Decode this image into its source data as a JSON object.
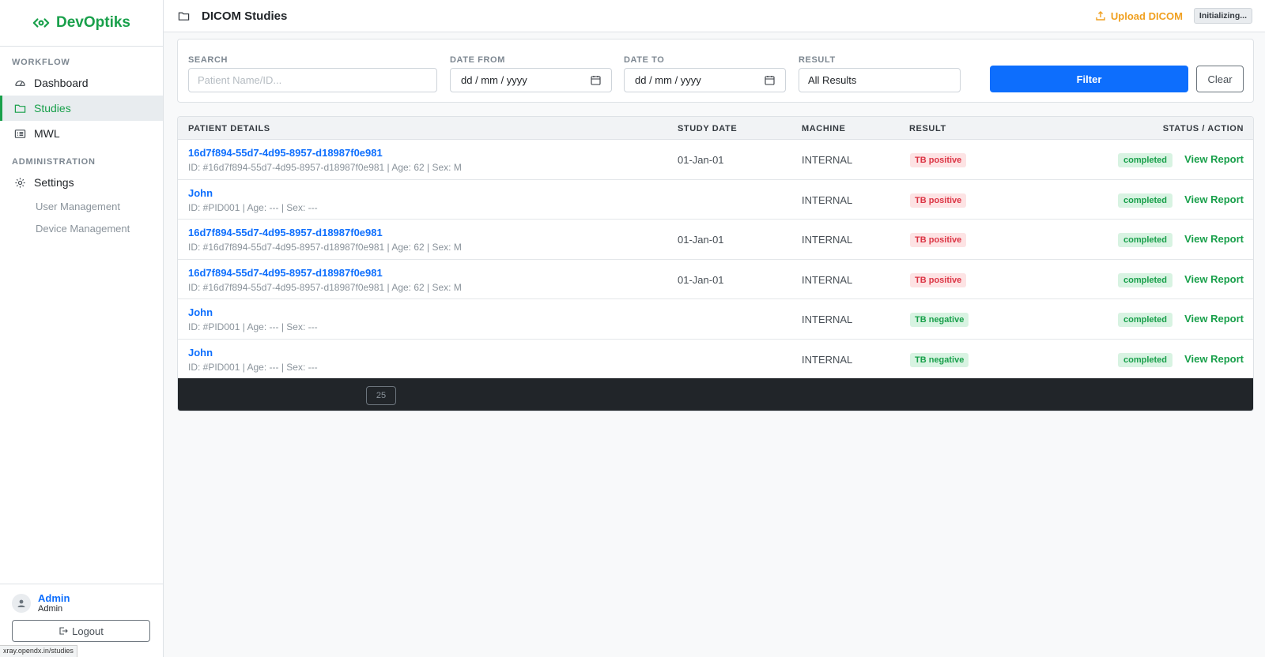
{
  "app": {
    "brand": "DevOptiks",
    "brand_color": "#19a04b"
  },
  "sidebar": {
    "sections": [
      {
        "label": "WORKFLOW"
      },
      {
        "label": "ADMINISTRATION"
      }
    ],
    "items": [
      {
        "label": "Dashboard",
        "icon": "gauge-icon"
      },
      {
        "label": "Studies",
        "icon": "folder-icon",
        "active": true
      },
      {
        "label": "MWL",
        "icon": "list-card-icon"
      },
      {
        "label": "Settings",
        "icon": "gear-icon"
      }
    ],
    "sub_items": [
      {
        "label": "User Management"
      },
      {
        "label": "Device Management"
      }
    ],
    "user": {
      "name": "Admin",
      "role": "Admin"
    },
    "logout_label": "Logout"
  },
  "status_url": "xray.opendx.in/studies",
  "header": {
    "title": "DICOM Studies",
    "upload_label": "Upload DICOM",
    "status_badge": "Initializing..."
  },
  "filters": {
    "search_label": "SEARCH",
    "search_placeholder": "Patient Name/ID...",
    "date_from_label": "DATE FROM",
    "date_from_value": "dd / mm / yyyy",
    "date_to_label": "DATE TO",
    "date_to_value": "dd / mm / yyyy",
    "result_label": "RESULT",
    "result_value": "All Results",
    "filter_label": "Filter",
    "clear_label": "Clear"
  },
  "table": {
    "columns": [
      "PATIENT DETAILS",
      "STUDY DATE",
      "MACHINE",
      "RESULT",
      "STATUS / ACTION"
    ],
    "rows": [
      {
        "name": "16d7f894-55d7-4d95-8957-d18987f0e981",
        "meta": "ID: #16d7f894-55d7-4d95-8957-d18987f0e981 | Age: 62 | Sex: M",
        "date": "01-Jan-01",
        "machine": "INTERNAL",
        "result": "TB positive",
        "result_type": "positive",
        "status": "completed",
        "action": "View Report"
      },
      {
        "name": "John",
        "meta": "ID: #PID001 | Age: --- | Sex: ---",
        "date": "",
        "machine": "INTERNAL",
        "result": "TB positive",
        "result_type": "positive",
        "status": "completed",
        "action": "View Report"
      },
      {
        "name": "16d7f894-55d7-4d95-8957-d18987f0e981",
        "meta": "ID: #16d7f894-55d7-4d95-8957-d18987f0e981 | Age: 62 | Sex: M",
        "date": "01-Jan-01",
        "machine": "INTERNAL",
        "result": "TB positive",
        "result_type": "positive",
        "status": "completed",
        "action": "View Report"
      },
      {
        "name": "16d7f894-55d7-4d95-8957-d18987f0e981",
        "meta": "ID: #16d7f894-55d7-4d95-8957-d18987f0e981 | Age: 62 | Sex: M",
        "date": "01-Jan-01",
        "machine": "INTERNAL",
        "result": "TB positive",
        "result_type": "positive",
        "status": "completed",
        "action": "View Report"
      },
      {
        "name": "John",
        "meta": "ID: #PID001 | Age: --- | Sex: ---",
        "date": "",
        "machine": "INTERNAL",
        "result": "TB negative",
        "result_type": "negative",
        "status": "completed",
        "action": "View Report"
      },
      {
        "name": "John",
        "meta": "ID: #PID001 | Age: --- | Sex: ---",
        "date": "",
        "machine": "INTERNAL",
        "result": "TB negative",
        "result_type": "negative",
        "status": "completed",
        "action": "View Report"
      }
    ],
    "page_size": "25"
  }
}
